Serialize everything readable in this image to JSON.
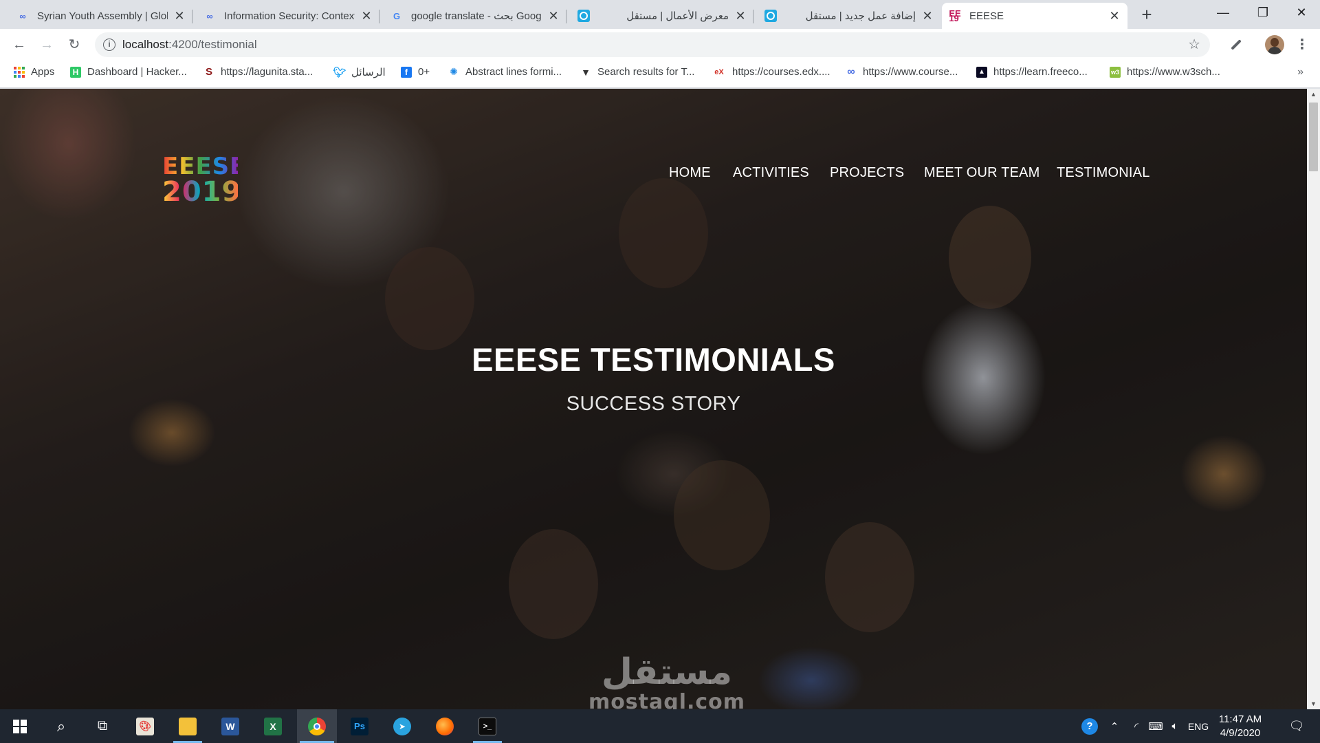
{
  "browser": {
    "tabs": [
      {
        "title": "Syrian Youth Assembly | Glob",
        "icon": "loop-icon",
        "active": false
      },
      {
        "title": "Information Security: Context",
        "icon": "loop-icon",
        "active": false
      },
      {
        "title": "google translate - بحث Google",
        "icon": "google-icon",
        "active": false
      },
      {
        "title": "معرض الأعمال | مستقل",
        "icon": "mostaql-icon",
        "active": false
      },
      {
        "title": "إضافة عمل جديد | مستقل",
        "icon": "mostaql-icon",
        "active": false
      },
      {
        "title": "EEESE",
        "icon": "eeese-icon",
        "active": true
      }
    ],
    "url_host": "localhost",
    "url_path": ":4200/testimonial",
    "bookmarks": [
      {
        "label": "Apps",
        "icon": "apps-grid-icon"
      },
      {
        "label": "Dashboard | Hacker...",
        "icon": "hackerrank-icon"
      },
      {
        "label": "https://lagunita.sta...",
        "icon": "stanford-icon"
      },
      {
        "label": "الرسائل",
        "icon": "twitter-icon"
      },
      {
        "label": "0+",
        "icon": "facebook-icon"
      },
      {
        "label": "Abstract lines formi...",
        "icon": "vector-icon"
      },
      {
        "label": "Search results for T...",
        "icon": "vectorstock-icon"
      },
      {
        "label": "https://courses.edx....",
        "icon": "edx-icon"
      },
      {
        "label": "https://www.course...",
        "icon": "coursera-icon"
      },
      {
        "label": "https://learn.freeco...",
        "icon": "freecodecamp-icon"
      },
      {
        "label": "https://www.w3sch...",
        "icon": "w3schools-icon"
      }
    ],
    "bookmarks_more": "»"
  },
  "site": {
    "logo_line1": "EEESE",
    "logo_line2": "2019",
    "nav": [
      "HOME",
      "ACTIVITIES",
      "PROJECTS",
      "MEET OUR TEAM",
      "TESTIMONIAL"
    ],
    "hero_title": "EEESE TESTIMONIALS",
    "hero_subtitle": "SUCCESS STORY",
    "watermark_ar": "مستقل",
    "watermark_en": "mostaql.com"
  },
  "taskbar": {
    "apps": [
      "start-icon",
      "search-icon",
      "task-view-icon",
      "paint-icon",
      "file-explorer-icon",
      "word-icon",
      "excel-icon",
      "chrome-icon",
      "photoshop-icon",
      "telegram-icon",
      "firefox-icon",
      "terminal-icon"
    ],
    "language": "ENG",
    "time": "11:47 AM",
    "date": "4/9/2020"
  },
  "colors": {
    "tab_strip": "#dee1e6",
    "taskbar": "#1f2630",
    "taskbar_accent": "#76b9ed",
    "hero_text": "#ffffff"
  }
}
